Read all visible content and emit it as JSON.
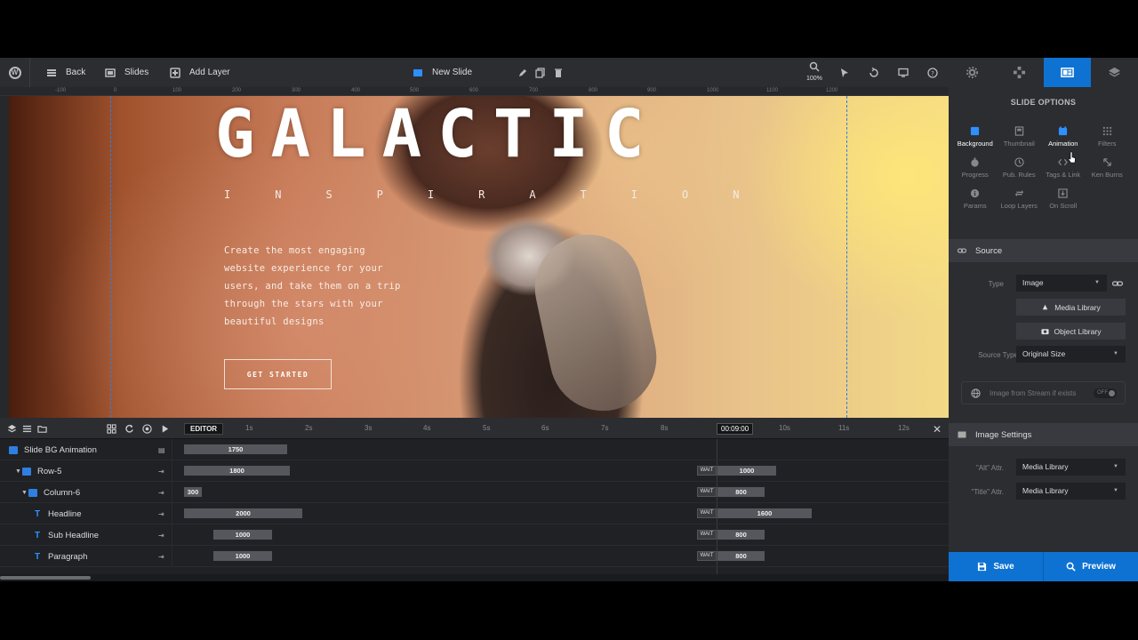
{
  "toolbar": {
    "back_label": "Back",
    "slides_label": "Slides",
    "add_layer_label": "Add Layer",
    "slide_name": "New Slide",
    "zoom_level": "100%"
  },
  "ruler": {
    "ticks": [
      "-100",
      "0",
      "100",
      "200",
      "300",
      "400",
      "500",
      "600",
      "700",
      "800",
      "900",
      "1000",
      "1100",
      "1200"
    ]
  },
  "canvas": {
    "headline": "GALACTIC",
    "subheadline": "INSPIRATION",
    "paragraph": "Create the most engaging website experience for your users, and take them on a trip through the stars with your beautiful designs",
    "cta_label": "GET STARTED"
  },
  "timeline": {
    "editor_label": "EDITOR",
    "time_marker": "00:09:00",
    "ticks": [
      "1s",
      "2s",
      "3s",
      "4s",
      "5s",
      "6s",
      "7s",
      "8s",
      "9s",
      "10s",
      "11s",
      "12s"
    ],
    "wait_label": "WAIT",
    "rows": [
      {
        "name": "Slide BG Animation",
        "bar1": "1750",
        "bar2": ""
      },
      {
        "name": "Row-5",
        "bar1": "1800",
        "bar2": "1000"
      },
      {
        "name": "Column-6",
        "bar1": "300",
        "bar2": "800"
      },
      {
        "name": "Headline",
        "bar1": "2000",
        "bar2": "1600"
      },
      {
        "name": "Sub Headline",
        "bar1": "1000",
        "bar2": "800"
      },
      {
        "name": "Paragraph",
        "bar1": "1000",
        "bar2": "800"
      }
    ]
  },
  "panel": {
    "title": "SLIDE OPTIONS",
    "options": [
      {
        "label": "Background",
        "icon": "image-icon"
      },
      {
        "label": "Thumbnail",
        "icon": "thumbnail-icon"
      },
      {
        "label": "Animation",
        "icon": "animation-icon"
      },
      {
        "label": "Filters",
        "icon": "filters-icon"
      },
      {
        "label": "Progress",
        "icon": "progress-icon"
      },
      {
        "label": "Pub. Rules",
        "icon": "clock-icon"
      },
      {
        "label": "Tags & Link",
        "icon": "code-icon"
      },
      {
        "label": "Ken Burns",
        "icon": "ken-burns-icon"
      },
      {
        "label": "Params",
        "icon": "info-icon"
      },
      {
        "label": "Loop Layers",
        "icon": "loop-icon"
      },
      {
        "label": "On Scroll",
        "icon": "scroll-icon"
      }
    ],
    "source": {
      "header": "Source",
      "type_label": "Type",
      "type_value": "Image",
      "media_library": "Media Library",
      "object_library": "Object Library",
      "source_type_label": "Source Type",
      "source_type_value": "Original Size",
      "stream_label": "Image from Stream if exists",
      "stream_toggle": "OFF"
    },
    "image_settings": {
      "header": "Image Settings",
      "alt_label": "\"Alt\" Attr.",
      "alt_value": "Media Library",
      "title_label": "\"Title\" Attr.",
      "title_value": "Media Library"
    }
  },
  "footer": {
    "save_label": "Save",
    "preview_label": "Preview"
  },
  "colors": {
    "accent": "#0e72d2",
    "panel_bg": "#2b2d31",
    "guide": "#2d7fe0"
  }
}
